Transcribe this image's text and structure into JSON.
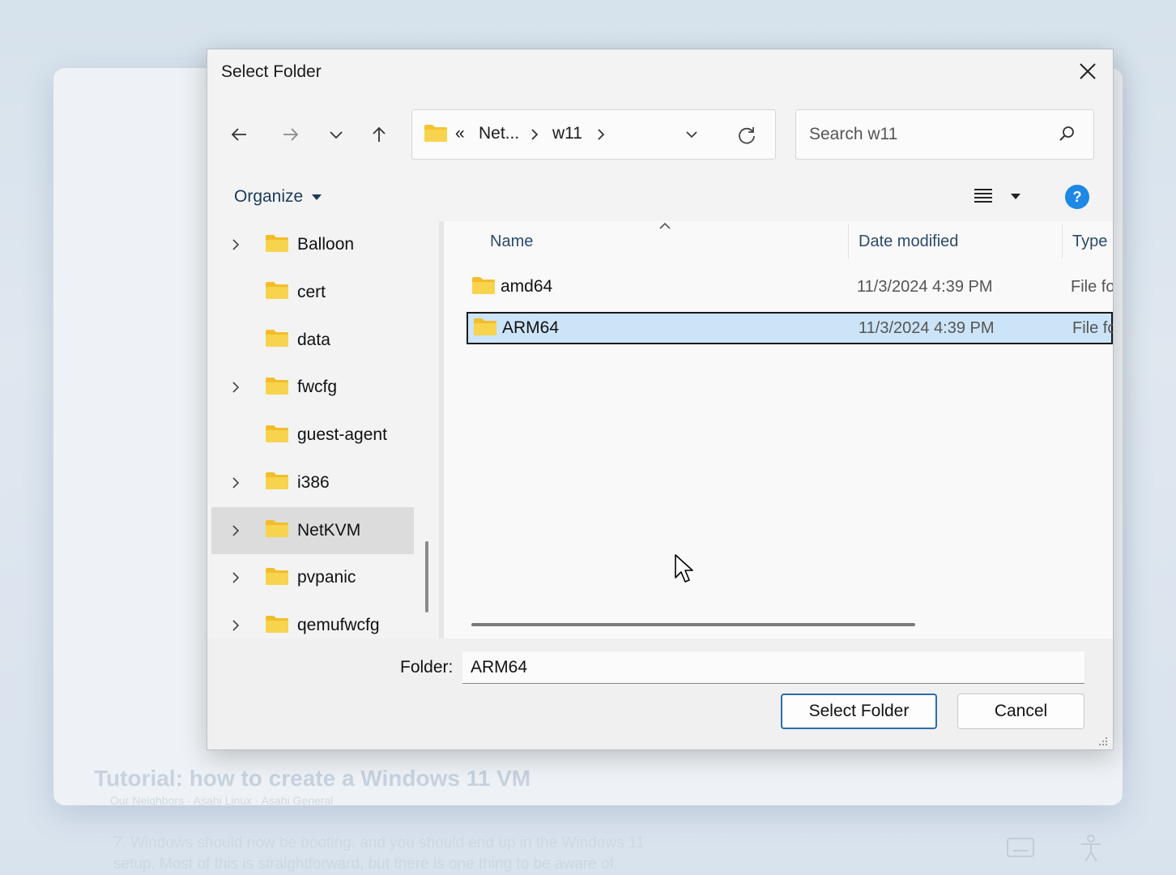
{
  "dialog": {
    "title": "Select Folder"
  },
  "address": {
    "overflow": "«",
    "segments": [
      "Net...",
      "w11"
    ]
  },
  "search": {
    "placeholder": "Search w11"
  },
  "toolbar": {
    "organize_label": "Organize",
    "help_label": "?"
  },
  "tree": {
    "items": [
      {
        "label": "Balloon",
        "expandable": true
      },
      {
        "label": "cert",
        "expandable": false
      },
      {
        "label": "data",
        "expandable": false
      },
      {
        "label": "fwcfg",
        "expandable": true
      },
      {
        "label": "guest-agent",
        "expandable": false
      },
      {
        "label": "i386",
        "expandable": true
      },
      {
        "label": "NetKVM",
        "expandable": true,
        "selected": true
      },
      {
        "label": "pvpanic",
        "expandable": true
      },
      {
        "label": "qemufwcfg",
        "expandable": true
      }
    ]
  },
  "files": {
    "columns": {
      "name": "Name",
      "date": "Date modified",
      "type": "Type"
    },
    "rows": [
      {
        "name": "amd64",
        "date": "11/3/2024 4:39 PM",
        "type": "File fo",
        "selected": false
      },
      {
        "name": "ARM64",
        "date": "11/3/2024 4:39 PM",
        "type": "File fo",
        "selected": true
      }
    ]
  },
  "footer": {
    "folder_label": "Folder:",
    "folder_value": "ARM64",
    "select_button": "Select Folder",
    "cancel_button": "Cancel"
  },
  "background": {
    "page_title": "Tutorial: how to create a Windows 11 VM",
    "breadcrumb": "Our Neighbors · Asahi Linux · Asahi General",
    "body_line1": "7. Windows should now be booting, and you should end up in the Windows 11",
    "body_line2": "setup. Most of this is straightforward, but there is one thing to be aware of:"
  },
  "colors": {
    "accent": "#2b6cb0",
    "selection": "#cce4f7",
    "folder": "#f4c430",
    "help": "#1e88e5"
  }
}
